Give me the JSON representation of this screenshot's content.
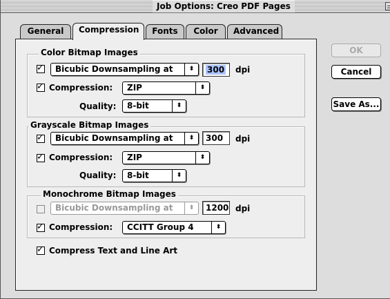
{
  "window": {
    "title": "Job Options: Creo PDF Pages"
  },
  "tabs": [
    {
      "label": "General",
      "active": false
    },
    {
      "label": "Compression",
      "active": true
    },
    {
      "label": "Fonts",
      "active": false
    },
    {
      "label": "Color",
      "active": false
    },
    {
      "label": "Advanced",
      "active": false
    }
  ],
  "color_bitmap": {
    "title": "Color Bitmap Images",
    "downsample_checked": true,
    "downsample_method": "Bicubic Downsampling at",
    "resolution": "300",
    "resolution_unit": "dpi",
    "compression_checked": true,
    "compression_label": "Compression:",
    "compression_value": "ZIP",
    "quality_label": "Quality:",
    "quality_value": "8-bit"
  },
  "grayscale_bitmap": {
    "title": "Grayscale Bitmap Images",
    "downsample_checked": true,
    "downsample_method": "Bicubic Downsampling at",
    "resolution": "300",
    "resolution_unit": "dpi",
    "compression_checked": true,
    "compression_label": "Compression:",
    "compression_value": "ZIP",
    "quality_label": "Quality:",
    "quality_value": "8-bit"
  },
  "monochrome_bitmap": {
    "title": "Monochrome Bitmap Images",
    "downsample_checked": false,
    "downsample_method": "Bicubic Downsampling at",
    "resolution": "1200",
    "resolution_unit": "dpi",
    "compression_checked": true,
    "compression_label": "Compression:",
    "compression_value": "CCITT Group 4"
  },
  "compress_text": {
    "checked": true,
    "label": "Compress Text and Line Art"
  },
  "buttons": {
    "ok": "OK",
    "cancel": "Cancel",
    "save_as": "Save As..."
  },
  "icons": {
    "popup_arrows": "⬍",
    "check": "✓"
  }
}
